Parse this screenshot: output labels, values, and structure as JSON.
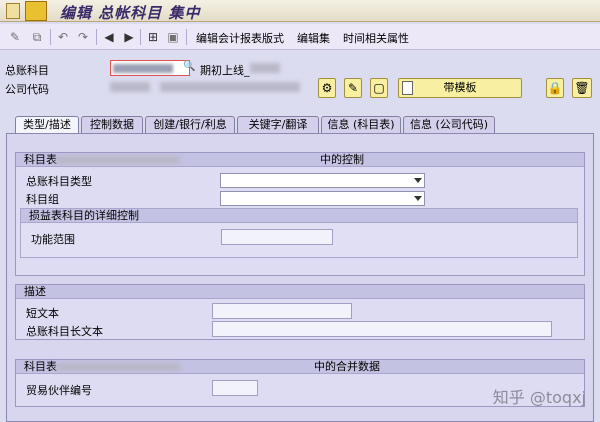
{
  "title": "编辑 总帐科目 集中",
  "toolbar": {
    "items": [
      "编辑会计报表版式",
      "编辑集",
      "时间相关属性"
    ]
  },
  "header": {
    "gl_account_label": "总账科目",
    "company_code_label": "公司代码",
    "gl_account_desc": "期初上线_",
    "template_button": "带模板"
  },
  "tabs": [
    "类型/描述",
    "控制数据",
    "创建/银行/利息",
    "关键字/翻译",
    "信息 (科目表)",
    "信息 (公司代码)"
  ],
  "control": {
    "header_left": "科目表",
    "header_right": "中的控制",
    "account_type_label": "总账科目类型",
    "account_group_label": "科目组",
    "pl_header": "损益表科目的详细控制",
    "functional_area_label": "功能范围"
  },
  "description": {
    "header": "描述",
    "short_text_label": "短文本",
    "long_text_label": "总账科目长文本"
  },
  "consolidation": {
    "header_left": "科目表",
    "header_right": "中的合并数据",
    "trading_partner_label": "贸易伙伴编号"
  },
  "watermark": "知乎 @toqxj"
}
